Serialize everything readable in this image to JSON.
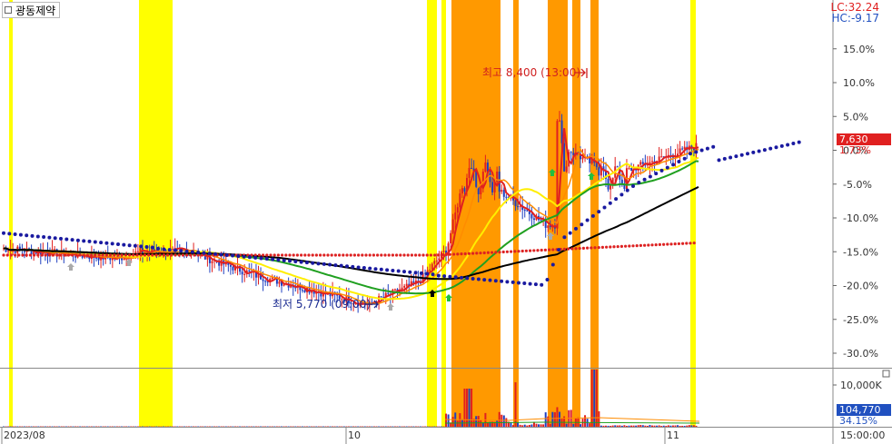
{
  "window": {
    "title": "광동제약"
  },
  "header": {
    "lc": "LC:32.24",
    "hc": "HC:-9.17"
  },
  "tags": {
    "price": "7,630",
    "price_change": "1.73%",
    "volume": "104,770",
    "volume_change": "34.15%"
  },
  "colors": {
    "highlight_yellow": "#ffff00",
    "highlight_orange": "#ff9900",
    "up": "#e02020",
    "down": "#2040c0",
    "ma_red": "#e02020",
    "ma_orange": "#ff8c00",
    "ma_yellow": "#ffee00",
    "ma_green": "#20a020",
    "ma_black": "#000000",
    "dots_red": "#dd2222",
    "dots_blue": "#1a1aa0"
  },
  "chart_data": {
    "type": "candlestick",
    "y_unit": "%",
    "y_ticks": [
      "15.0%",
      "10.0%",
      "5.0%",
      "0.0%",
      "-5.0%",
      "-10.0%",
      "-15.0%",
      "-20.0%",
      "-25.0%",
      "-30.0%"
    ],
    "x_ticks": [
      "2023/08",
      "10",
      "11",
      "15:00:00"
    ],
    "volume_ticks": [
      "10,000K"
    ],
    "annotations": {
      "high": "최고 8,400 (13:00)",
      "low": "최저 5,770 (09:00)"
    },
    "reference_lines": {
      "red_dots_level": -15.5
    }
  }
}
